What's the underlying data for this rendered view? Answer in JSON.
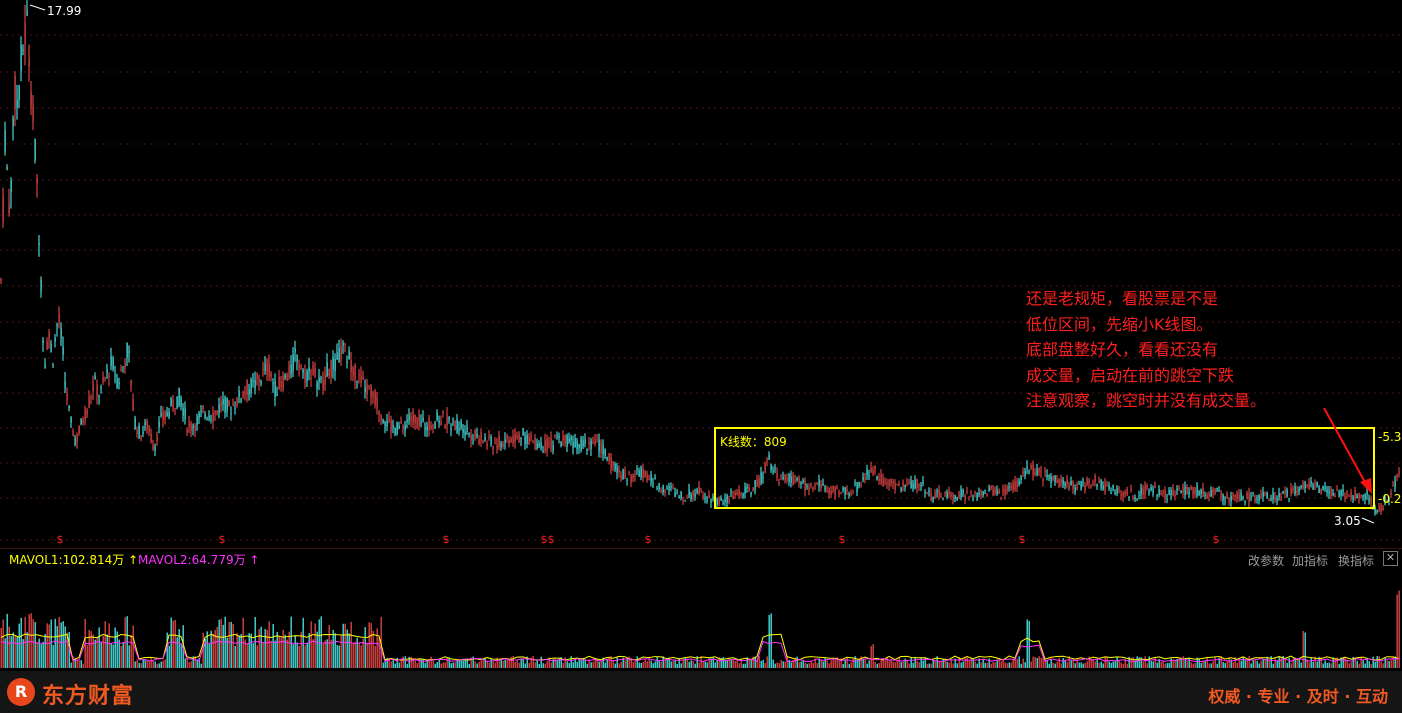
{
  "chart_data": {
    "type": "candlestick",
    "price_high_label": "17.99",
    "price_low_label": "3.05",
    "right_scale_labels": [
      "-5.3",
      "-0.2"
    ],
    "box_label": "K线数：809",
    "marker_glyph": "$",
    "ylim": [
      2.5,
      18.5
    ],
    "close_path": [
      [
        0,
        9.0
      ],
      [
        5,
        14.5
      ],
      [
        10,
        12.0
      ],
      [
        14,
        16.0
      ],
      [
        17,
        15.5
      ],
      [
        22,
        17.0
      ],
      [
        27,
        17.99
      ],
      [
        31,
        16.0
      ],
      [
        36,
        13.5
      ],
      [
        40,
        11.0
      ],
      [
        44,
        7.5
      ],
      [
        48,
        8.5
      ],
      [
        53,
        7.8
      ],
      [
        58,
        9.0
      ],
      [
        62,
        8.2
      ],
      [
        66,
        6.7
      ],
      [
        71,
        5.7
      ],
      [
        76,
        5.2
      ],
      [
        82,
        5.8
      ],
      [
        88,
        6.3
      ],
      [
        94,
        7.0
      ],
      [
        100,
        6.6
      ],
      [
        106,
        7.2
      ],
      [
        112,
        7.6
      ],
      [
        118,
        7.0
      ],
      [
        124,
        7.6
      ],
      [
        128,
        8.1
      ],
      [
        134,
        5.9
      ],
      [
        140,
        5.4
      ],
      [
        147,
        5.7
      ],
      [
        154,
        5.0
      ],
      [
        160,
        5.8
      ],
      [
        166,
        6.0
      ],
      [
        172,
        6.3
      ],
      [
        180,
        6.6
      ],
      [
        188,
        5.6
      ],
      [
        196,
        5.8
      ],
      [
        205,
        6.1
      ],
      [
        214,
        6.0
      ],
      [
        222,
        6.4
      ],
      [
        230,
        6.2
      ],
      [
        238,
        6.5
      ],
      [
        246,
        6.8
      ],
      [
        254,
        6.9
      ],
      [
        262,
        7.2
      ],
      [
        268,
        7.5
      ],
      [
        275,
        6.8
      ],
      [
        282,
        7.0
      ],
      [
        290,
        7.3
      ],
      [
        296,
        7.9
      ],
      [
        304,
        7.2
      ],
      [
        312,
        7.4
      ],
      [
        320,
        6.9
      ],
      [
        328,
        7.4
      ],
      [
        335,
        7.5
      ],
      [
        342,
        8.0
      ],
      [
        350,
        7.7
      ],
      [
        358,
        7.1
      ],
      [
        366,
        6.8
      ],
      [
        374,
        6.6
      ],
      [
        382,
        6.0
      ],
      [
        392,
        5.6
      ],
      [
        402,
        5.6
      ],
      [
        412,
        6.0
      ],
      [
        422,
        5.7
      ],
      [
        432,
        5.8
      ],
      [
        442,
        5.9
      ],
      [
        452,
        5.7
      ],
      [
        462,
        5.7
      ],
      [
        472,
        5.4
      ],
      [
        482,
        5.3
      ],
      [
        492,
        5.1
      ],
      [
        502,
        5.2
      ],
      [
        512,
        5.3
      ],
      [
        522,
        5.4
      ],
      [
        532,
        5.2
      ],
      [
        542,
        5.1
      ],
      [
        552,
        5.1
      ],
      [
        562,
        5.3
      ],
      [
        572,
        5.2
      ],
      [
        582,
        5.1
      ],
      [
        592,
        5.2
      ],
      [
        602,
        5.0
      ],
      [
        612,
        4.5
      ],
      [
        622,
        4.2
      ],
      [
        632,
        4.1
      ],
      [
        642,
        4.3
      ],
      [
        652,
        4.0
      ],
      [
        662,
        3.8
      ],
      [
        672,
        3.7
      ],
      [
        680,
        3.5
      ],
      [
        690,
        3.6
      ],
      [
        700,
        3.7
      ],
      [
        710,
        3.5
      ],
      [
        720,
        3.4
      ],
      [
        730,
        3.5
      ],
      [
        740,
        3.6
      ],
      [
        750,
        3.7
      ],
      [
        760,
        4.0
      ],
      [
        768,
        4.7
      ],
      [
        774,
        4.3
      ],
      [
        782,
        4.0
      ],
      [
        790,
        4.1
      ],
      [
        800,
        3.9
      ],
      [
        810,
        3.8
      ],
      [
        820,
        3.9
      ],
      [
        830,
        3.7
      ],
      [
        840,
        3.6
      ],
      [
        850,
        3.7
      ],
      [
        858,
        3.8
      ],
      [
        866,
        4.2
      ],
      [
        874,
        4.3
      ],
      [
        882,
        4.0
      ],
      [
        892,
        3.9
      ],
      [
        902,
        3.8
      ],
      [
        912,
        3.9
      ],
      [
        922,
        3.9
      ],
      [
        932,
        3.5
      ],
      [
        942,
        3.6
      ],
      [
        952,
        3.5
      ],
      [
        962,
        3.6
      ],
      [
        972,
        3.5
      ],
      [
        982,
        3.6
      ],
      [
        992,
        3.7
      ],
      [
        1002,
        3.6
      ],
      [
        1012,
        3.8
      ],
      [
        1020,
        4.0
      ],
      [
        1028,
        4.4
      ],
      [
        1036,
        4.3
      ],
      [
        1046,
        4.1
      ],
      [
        1056,
        4.0
      ],
      [
        1066,
        3.9
      ],
      [
        1076,
        3.8
      ],
      [
        1086,
        3.9
      ],
      [
        1096,
        4.0
      ],
      [
        1106,
        3.8
      ],
      [
        1116,
        3.7
      ],
      [
        1126,
        3.6
      ],
      [
        1136,
        3.6
      ],
      [
        1146,
        3.7
      ],
      [
        1156,
        3.7
      ],
      [
        1166,
        3.6
      ],
      [
        1176,
        3.7
      ],
      [
        1186,
        3.7
      ],
      [
        1196,
        3.7
      ],
      [
        1206,
        3.6
      ],
      [
        1216,
        3.7
      ],
      [
        1226,
        3.5
      ],
      [
        1236,
        3.5
      ],
      [
        1246,
        3.5
      ],
      [
        1256,
        3.5
      ],
      [
        1266,
        3.5
      ],
      [
        1276,
        3.5
      ],
      [
        1286,
        3.6
      ],
      [
        1296,
        3.7
      ],
      [
        1304,
        3.9
      ],
      [
        1312,
        3.9
      ],
      [
        1322,
        3.7
      ],
      [
        1332,
        3.6
      ],
      [
        1342,
        3.6
      ],
      [
        1352,
        3.6
      ],
      [
        1360,
        3.5
      ],
      [
        1368,
        3.6
      ],
      [
        1374,
        3.1
      ],
      [
        1380,
        3.1
      ],
      [
        1386,
        3.3
      ],
      [
        1392,
        3.6
      ],
      [
        1398,
        4.3
      ]
    ]
  },
  "volume_panel": {
    "mavol1": "MAVOL1:102.814万",
    "mavol2": "MAVOL2:64.779万",
    "arrow_glyph": "↑",
    "buttons": [
      "改参数",
      "加指标",
      "换指标"
    ],
    "close_glyph": "✕"
  },
  "annotation": {
    "lines": [
      "还是老规矩，看股票是不是",
      "低位区间，先缩小K线图。",
      "底部盘整好久，看看还没有",
      "成交量，启动在前的跳空下跌",
      "注意观察，跳空时并没有成交量。"
    ]
  },
  "footer": {
    "brand": "东方财富",
    "logo_glyph": "R",
    "slogan": "权威 · 专业 · 及时 · 互动"
  },
  "colors": {
    "up": "#ff5050",
    "down": "#54ffff",
    "grid": "#4a1212",
    "box": "#ffff00",
    "annotation": "#ff1f1f",
    "mavol1": "#ffff00",
    "mavol2": "#ff33ff",
    "marker": "#ff2020",
    "brand": "#f05a22"
  }
}
